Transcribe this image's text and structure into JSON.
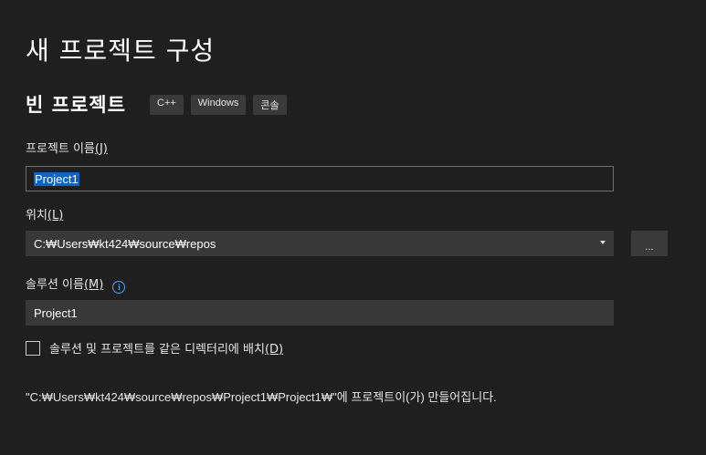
{
  "page": {
    "title": "새 프로젝트 구성",
    "template_name": "빈 프로젝트",
    "tags": [
      "C++",
      "Windows",
      "콘솔"
    ]
  },
  "project_name": {
    "label": "프로젝트 이름",
    "access_key": "(J)",
    "value": "Project1"
  },
  "location": {
    "label": "위치",
    "access_key": "(L)",
    "value": "C:₩Users₩kt424₩source₩repos",
    "browse_label": "..."
  },
  "solution_name": {
    "label": "솔루션 이름",
    "access_key": "(M)",
    "value": "Project1",
    "info_icon": "info-icon"
  },
  "same_directory": {
    "label": "솔루션 및 프로젝트를 같은 디렉터리에 배치",
    "access_key": "(D)",
    "checked": false
  },
  "summary": {
    "text": "\"C:₩Users₩kt424₩source₩repos₩Project1₩Project1₩\"에 프로젝트이(가) 만들어집니다."
  },
  "colors": {
    "background": "#1f1f1f",
    "accent": "#0a64c8",
    "info": "#4aa3ff"
  }
}
